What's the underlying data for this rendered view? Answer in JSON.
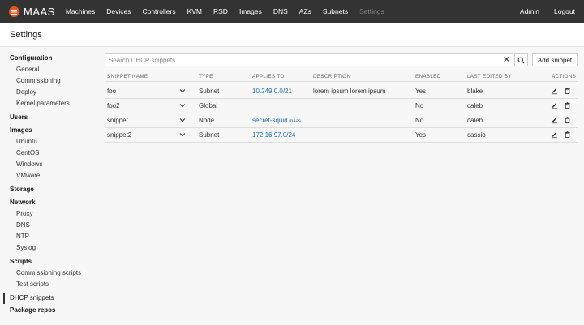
{
  "nav": {
    "brand": "MAAS",
    "items": [
      "Machines",
      "Devices",
      "Controllers",
      "KVM",
      "RSD",
      "Images",
      "DNS",
      "AZs",
      "Subnets",
      "Settings"
    ],
    "right": [
      "Admin",
      "Logout"
    ]
  },
  "page": {
    "title": "Settings"
  },
  "sidebar": {
    "sections": [
      {
        "heading": "Configuration",
        "items": [
          "General",
          "Commissioning",
          "Deploy",
          "Kernel parameters"
        ]
      },
      {
        "heading": "Users",
        "items": []
      },
      {
        "heading": "Images",
        "items": [
          "Ubuntu",
          "CentOS",
          "Windows",
          "VMware"
        ]
      },
      {
        "heading": "Storage",
        "items": []
      },
      {
        "heading": "Network",
        "items": [
          "Proxy",
          "DNS",
          "NTP",
          "Syslog"
        ]
      },
      {
        "heading": "Scripts",
        "items": [
          "Commissioning scripts",
          "Test scripts"
        ]
      },
      {
        "heading": "DHCP snippets",
        "items": []
      },
      {
        "heading": "Package repos",
        "items": []
      }
    ],
    "active": "DHCP snippets"
  },
  "search": {
    "placeholder": "Search DHCP snippets",
    "value": ""
  },
  "buttons": {
    "add_snippet": "Add snippet"
  },
  "table": {
    "headers": [
      "SNIPPET NAME",
      "TYPE",
      "APPLIES TO",
      "DESCRIPTION",
      "ENABLED",
      "LAST EDITED BY",
      "ACTIONS"
    ],
    "rows": [
      {
        "name": "foo",
        "type": "Subnet",
        "applies_to": "10.249.0.0/21",
        "applies_suffix": "",
        "description": "lorem ipsum lorem ipsum",
        "enabled": "Yes",
        "edited_by": "blake"
      },
      {
        "name": "foo2",
        "type": "Global",
        "applies_to": "",
        "applies_suffix": "",
        "description": "",
        "enabled": "No",
        "edited_by": "caleb"
      },
      {
        "name": "snippet",
        "type": "Node",
        "applies_to": "secret-squid",
        "applies_suffix": ".maas",
        "description": "",
        "enabled": "No",
        "edited_by": "caleb"
      },
      {
        "name": "snippet2",
        "type": "Subnet",
        "applies_to": "172.16.97.0/24",
        "applies_suffix": "",
        "description": "",
        "enabled": "Yes",
        "edited_by": "cassio"
      }
    ]
  },
  "colors": {
    "nav_bg": "#333333",
    "brand": "#e95420",
    "link": "#1f6fb0"
  },
  "icons": {
    "logo": "maas-logo-icon",
    "clear": "close-icon",
    "search": "search-icon",
    "expand": "chevron-down-icon",
    "edit": "pencil-icon",
    "delete": "trash-icon"
  }
}
